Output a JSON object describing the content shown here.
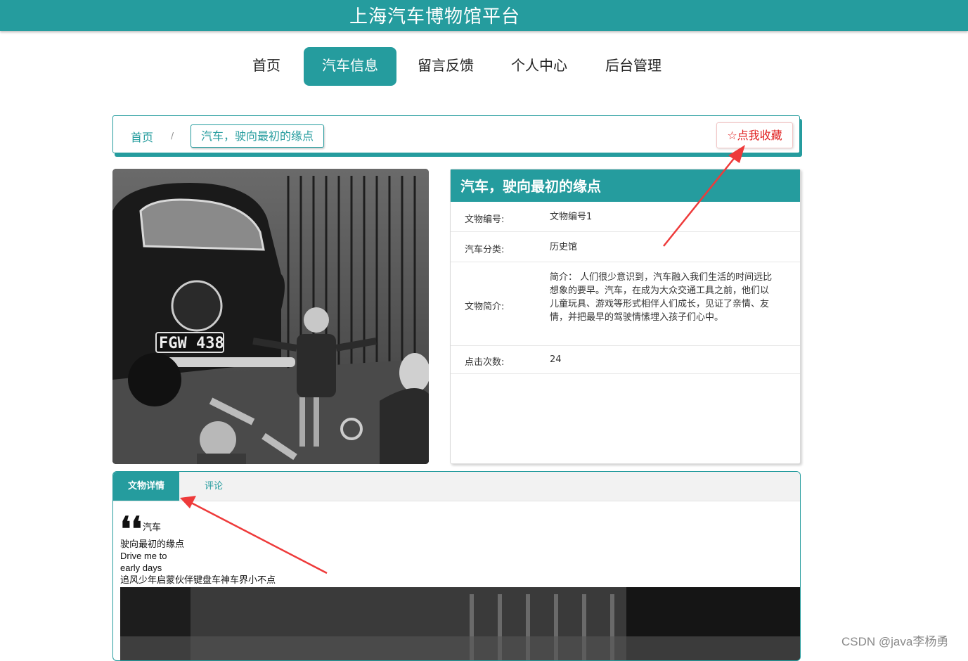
{
  "header": {
    "title": "上海汽车博物馆平台"
  },
  "nav": {
    "items": [
      {
        "label": "首页"
      },
      {
        "label": "汽车信息"
      },
      {
        "label": "留言反馈"
      },
      {
        "label": "个人中心"
      },
      {
        "label": "后台管理"
      }
    ],
    "active_index": 1
  },
  "breadcrumb": {
    "home": "首页",
    "separator": "/",
    "current": "汽车，驶向最初的缘点"
  },
  "favorite": {
    "label": "点我收藏",
    "icon": "star-outline-icon"
  },
  "photo": {
    "plate": "FGW 438"
  },
  "info": {
    "title": "汽车，驶向最初的缘点",
    "rows": [
      {
        "label": "文物编号:",
        "value": "文物编号1"
      },
      {
        "label": "汽车分类:",
        "value": "历史馆"
      },
      {
        "label": "文物简介:",
        "value": "简介： 人们很少意识到，汽车融入我们生活的时间远比想象的要早。汽车，在成为大众交通工具之前，他们以儿童玩具、游戏等形式相伴人们成长，见证了亲情、友情，并把最早的驾驶情愫埋入孩子们心中。"
      },
      {
        "label": "点击次数:",
        "value": "24"
      }
    ]
  },
  "tabs": {
    "items": [
      {
        "label": "文物详情"
      },
      {
        "label": "评论"
      }
    ],
    "active_index": 0
  },
  "detail": {
    "quote_mark": "❛❛",
    "lines": [
      "汽车",
      "驶向最初的缘点",
      "Drive me to",
      "early days",
      "追风少年启蒙伙伴键盘车神车界小不点"
    ]
  },
  "watermark": "CSDN @java李杨勇",
  "colors": {
    "primary": "#259c9e",
    "accent_red": "#e02020"
  }
}
